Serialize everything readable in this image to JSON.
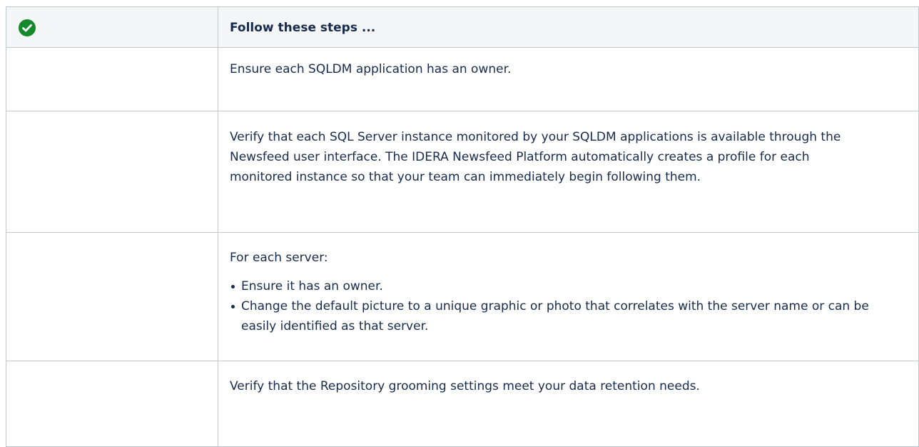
{
  "header": {
    "icon": "check-circle-icon",
    "icon_color": "#14892c",
    "title": "Follow these steps ..."
  },
  "rows": [
    {
      "text": "Ensure each SQLDM application has an owner."
    },
    {
      "text": "Verify that each SQL Server instance monitored by your SQLDM applications is available through the Newsfeed user interface. The IDERA Newsfeed Platform automatically creates a profile for each monitored instance so that your team can immediately begin following them."
    },
    {
      "text": "For each server:",
      "bullets": [
        "Ensure it has an owner.",
        "Change the default picture to a unique graphic or photo that correlates with the server name or can be easily identified as that server."
      ]
    },
    {
      "text": "Verify that the Repository grooming settings meet your data retention needs."
    }
  ]
}
